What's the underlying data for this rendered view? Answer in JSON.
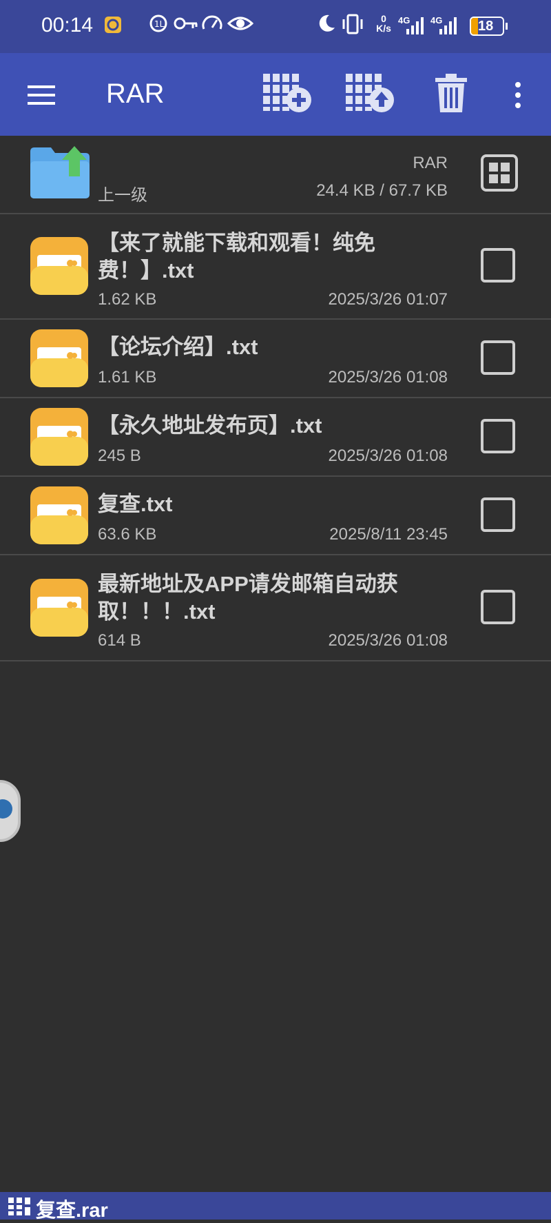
{
  "status": {
    "time": "00:14",
    "net_speed_value": "0",
    "net_speed_unit": "K/s",
    "sim1": "4G",
    "sim2": "4G",
    "battery": "18"
  },
  "appbar": {
    "title": "RAR",
    "icons": [
      "menu-icon",
      "add-to-archive-icon",
      "extract-upload-icon",
      "trash-icon",
      "more-vert-icon"
    ]
  },
  "parent": {
    "label": "上一级",
    "archive_name": "RAR",
    "size_ratio": "24.4 KB / 67.7 KB"
  },
  "files": [
    {
      "name_line1": "【来了就能下载和观看！纯免",
      "name_line2": "费！】.txt",
      "size": "1.62 KB",
      "date": "2025/3/26 01:07"
    },
    {
      "name_line1": "【论坛介绍】.txt",
      "name_line2": "",
      "size": "1.61 KB",
      "date": "2025/3/26 01:08"
    },
    {
      "name_line1": "【永久地址发布页】.txt",
      "name_line2": "",
      "size": "245 B",
      "date": "2025/3/26 01:08"
    },
    {
      "name_line1": "复查.txt",
      "name_line2": "",
      "size": "63.6 KB",
      "date": "2025/8/11 23:45"
    },
    {
      "name_line1": "最新地址及APP请发邮箱自动获",
      "name_line2": "取！！！.txt",
      "size": "614 B",
      "date": "2025/3/26 01:08"
    }
  ],
  "bottombar": {
    "archive_label": "复查.rar"
  },
  "colors": {
    "statusbar": "#3a4799",
    "appbar": "#3f51b5",
    "background": "#2f2f2f",
    "file_icon": "#f6bf3a"
  }
}
